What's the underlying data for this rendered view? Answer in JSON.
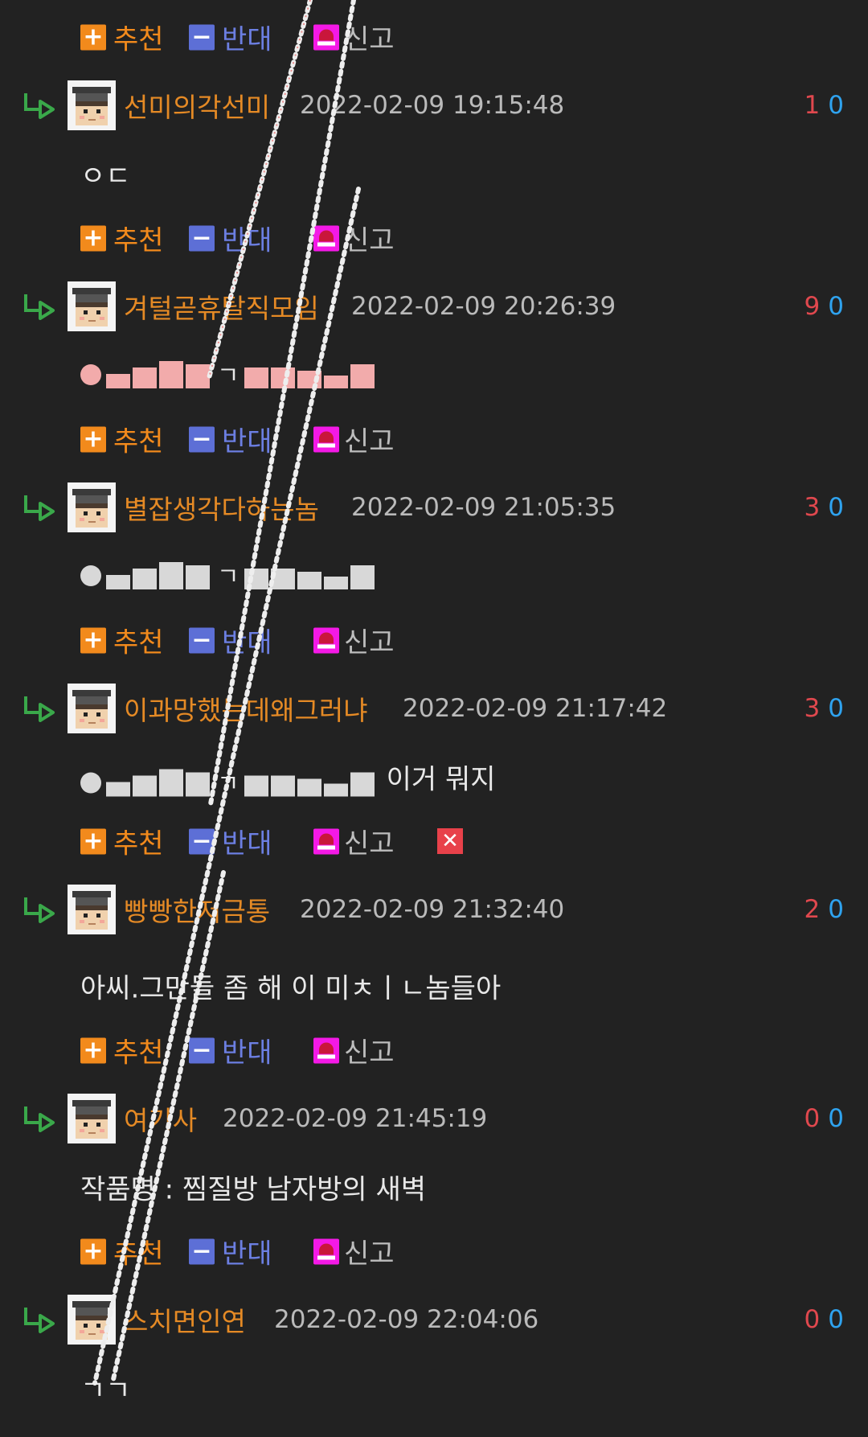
{
  "actions": {
    "recommend_label": "추천",
    "oppose_label": "반대",
    "report_label": "신고",
    "plus_symbol": "+",
    "minus_symbol": "−",
    "delete_symbol": "✕"
  },
  "colors": {
    "background": "#222222",
    "nickname": "#e58a25",
    "upvote": "#e0484e",
    "downvote": "#2fa3ef",
    "recommend": "#f28a1c",
    "oppose": "#5d6fd6",
    "report_icon": "#f419e6",
    "reply_arrow": "#3aa84a"
  },
  "comments": [
    {
      "nickname": "선미의각선미",
      "date": "2022-02-09 19:15:48",
      "up": "1",
      "down": "0",
      "text": "ㅇㄷ"
    },
    {
      "nickname": "겨털곧휴탈직모임",
      "date": "2022-02-09 20:26:39",
      "up": "9",
      "down": "0",
      "censored_suffix": "ㄱ",
      "text": ""
    },
    {
      "nickname": "별잡생각다하는놈",
      "date": "2022-02-09 21:05:35",
      "up": "3",
      "down": "0",
      "censored_suffix": "ㄱ",
      "text": ""
    },
    {
      "nickname": "이과망했는데왜그러냐",
      "date": "2022-02-09 21:17:42",
      "up": "3",
      "down": "0",
      "censored_suffix": "ㄱ",
      "text": "이거 뭐지"
    },
    {
      "nickname": "빵빵한저금통",
      "date": "2022-02-09 21:32:40",
      "up": "2",
      "down": "0",
      "text": "아씨.그만들 좀 해 이 미ㅊㅣㄴ놈들아"
    },
    {
      "nickname": "여기사",
      "date": "2022-02-09 21:45:19",
      "up": "0",
      "down": "0",
      "text": "작품명 : 찜질방 남자방의 새벽"
    },
    {
      "nickname": "스치면인연",
      "date": "2022-02-09 22:04:06",
      "up": "0",
      "down": "0",
      "text": "ㄱㄱ"
    }
  ]
}
